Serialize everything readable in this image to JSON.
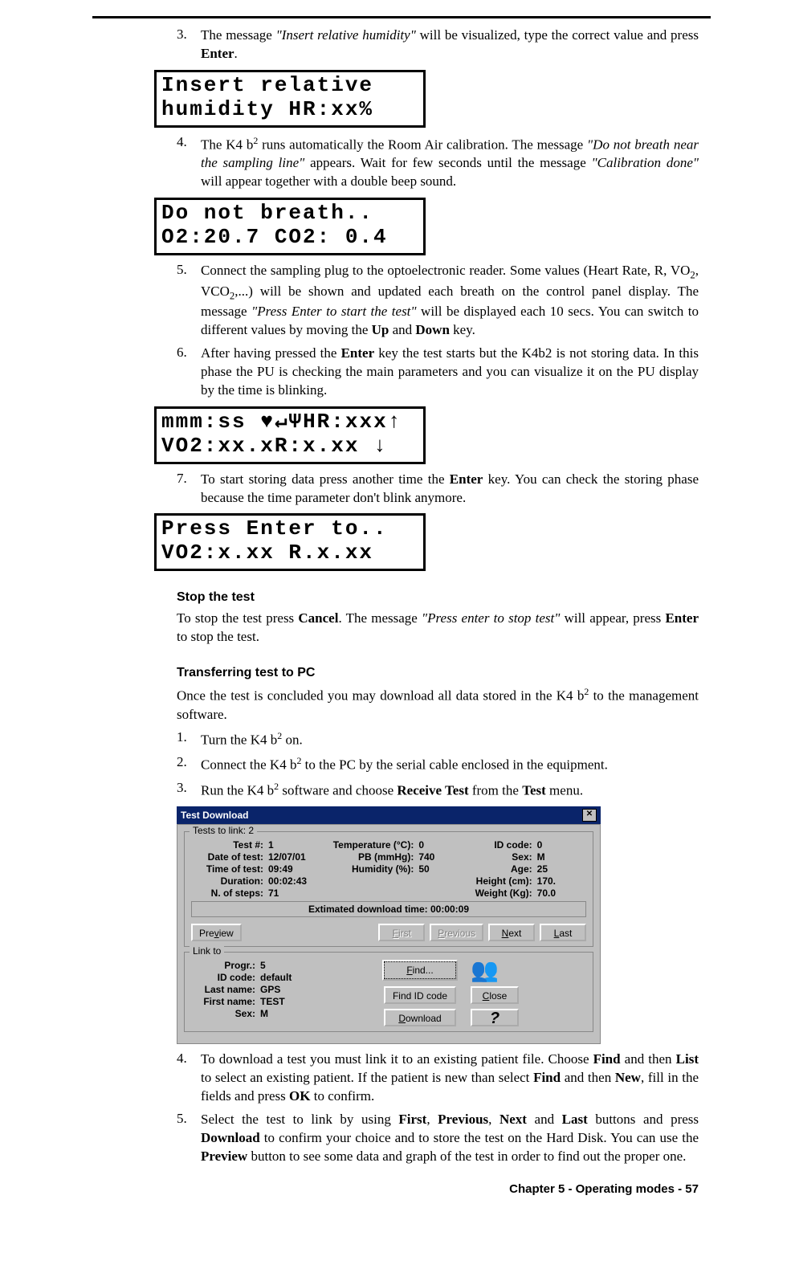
{
  "step3": {
    "num": "3.",
    "text_a": "The message ",
    "text_quote": "\"Insert relative humidity\"",
    "text_b": " will be visualized, type the correct value and press ",
    "text_bold": "Enter",
    "text_c": "."
  },
  "lcd1": {
    "line1": "Insert relative",
    "line2": "humidity HR:xx%"
  },
  "step4": {
    "num": "4.",
    "a": "The K4 b",
    "sup1": "2",
    "b": " runs automatically the Room Air calibration. The message ",
    "q1": "\"Do not breath near the sampling line\"",
    "c": " appears. Wait for few seconds until the message ",
    "q2": "\"Calibration done\"",
    "d": " will appear together with a double beep sound."
  },
  "lcd2": {
    "line1": "Do not breath..",
    "line2": "O2:20.7 CO2: 0.4"
  },
  "step5": {
    "num": "5.",
    "a": "Connect the sampling plug to the optoelectronic reader. Some values (Heart Rate, R, VO",
    "sub1": "2",
    "b": ", VCO",
    "sub2": "2",
    "c": ",...) will be shown and updated each breath on the control panel display. The message ",
    "q": "\"Press Enter to start the test\"",
    "d": " will be displayed each 10 secs. You can switch to different values by moving the ",
    "bold1": "Up",
    "e": " and ",
    "bold2": "Down",
    "f": " key."
  },
  "step6": {
    "num": "6.",
    "a": "After having pressed the ",
    "bold1": "Enter",
    "b": " key the test starts but the K4b2 is not storing data. In this phase the PU is checking the main parameters and you can visualize it on the PU display by the time is blinking."
  },
  "lcd3": {
    "line1": "mmm:ss ♥↵ΨHR:xxx↑",
    "line2": "VO2:xx.xR:x.xx ↓"
  },
  "step7": {
    "num": "7.",
    "a": "To start storing data press another time the ",
    "bold1": "Enter",
    "b": " key. You can check the storing phase because the time parameter don't blink anymore."
  },
  "lcd4": {
    "line1": "Press Enter to..",
    "line2": "VO2:x.xx R.x.xx"
  },
  "stop": {
    "heading": "Stop the test",
    "a": "To stop the test press ",
    "bold1": "Cancel",
    "b": ". The message ",
    "q": "\"Press enter to stop test\"",
    "c": " will appear, press ",
    "bold2": "Enter",
    "d": " to stop the test."
  },
  "transfer": {
    "heading": "Transferring test to PC",
    "intro_a": "Once the test is concluded you may download all data stored in the K4 b",
    "intro_sup": "2",
    "intro_b": " to the management software.",
    "t1": {
      "num": "1.",
      "a": "Turn the K4 b",
      "sup": "2",
      "b": " on."
    },
    "t2": {
      "num": "2.",
      "a": "Connect the K4 b",
      "sup": "2",
      "b": " to the PC by the serial cable enclosed in the equipment."
    },
    "t3": {
      "num": "3.",
      "a": "Run the K4 b",
      "sup": "2",
      "b": " software and choose ",
      "bold1": "Receive Test",
      "c": " from the ",
      "bold2": "Test",
      "d": " menu."
    }
  },
  "dialog": {
    "title": "Test Download",
    "close_x": "✕",
    "group1_title": "Tests to link: 2",
    "fields_left": [
      {
        "label": "Test #:",
        "value": "1"
      },
      {
        "label": "Date of test:",
        "value": "12/07/01"
      },
      {
        "label": "Time of test:",
        "value": "09:49"
      },
      {
        "label": "Duration:",
        "value": "00:02:43"
      },
      {
        "label": "N. of steps:",
        "value": "71"
      }
    ],
    "fields_mid": [
      {
        "label": "Temperature (°C):",
        "value": "0"
      },
      {
        "label": "PB (mmHg):",
        "value": "740"
      },
      {
        "label": "Humidity (%):",
        "value": "50"
      }
    ],
    "fields_right": [
      {
        "label": "ID code:",
        "value": "0"
      },
      {
        "label": "Sex:",
        "value": "M"
      },
      {
        "label": "Age:",
        "value": "25"
      },
      {
        "label": "Height (cm):",
        "value": "170."
      },
      {
        "label": "Weight (Kg):",
        "value": "70.0"
      }
    ],
    "estimated": "Extimated download time: 00:00:09",
    "buttons_row1": {
      "preview_u": "v",
      "preview": "Preview",
      "first_u": "F",
      "first": "irst",
      "previous_u": "P",
      "previous": "revious",
      "next_u": "N",
      "next": "ext",
      "last_u": "L",
      "last": "ast"
    },
    "group2_title": "Link to",
    "link_fields": [
      {
        "label": "Progr.:",
        "value": "5"
      },
      {
        "label": "ID code:",
        "value": "default"
      },
      {
        "label": "Last name:",
        "value": "GPS"
      },
      {
        "label": "First name:",
        "value": "TEST"
      },
      {
        "label": "Sex:",
        "value": "M"
      }
    ],
    "btn_find_u": "F",
    "btn_find": "ind...",
    "btn_findid": "Find ID code",
    "btn_download_u": "D",
    "btn_download": "ownload",
    "btn_close_u": "C",
    "btn_close": "lose",
    "btn_help": "?"
  },
  "after": {
    "t4": {
      "num": "4.",
      "a": "To download a test you must link it to an existing patient file. Choose ",
      "b1": "Find",
      "b": " and then ",
      "b2": "List",
      "c": " to select an existing patient. If the patient is new than select ",
      "b3": "Find",
      "d": " and then ",
      "b4": "New",
      "e": ", fill in the fields and press ",
      "b5": "OK",
      "f": " to confirm."
    },
    "t5": {
      "num": "5.",
      "a": "Select the test to link by using ",
      "b1": "First",
      "b": ", ",
      "b2": "Previous",
      "c": ", ",
      "b3": "Next",
      "d": " and ",
      "b4": "Last",
      "e": " buttons and press ",
      "b5": "Download",
      "f": " to confirm your choice and to store the test on the Hard Disk. You can use the ",
      "b6": "Preview",
      "g": " button to see some data and graph of the test in order to find out the proper one."
    }
  },
  "footer": "Chapter 5 - Operating modes - 57"
}
